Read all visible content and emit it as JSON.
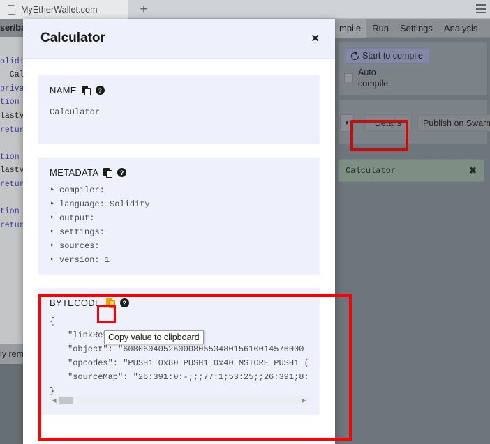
{
  "browser": {
    "tab_title": "MyEtherWallet.com",
    "new_tab_label": "+",
    "page_icon": "page-icon",
    "menu_icon": "hamburger-menu-icon"
  },
  "editor": {
    "path_label": "ser/ba",
    "lines": [
      {
        "text": "olidit",
        "kind": "kw"
      },
      {
        "text": "  Calcu",
        "kind": "pl"
      },
      {
        "text": "privat",
        "kind": "kw"
      },
      {
        "text": "tion A",
        "kind": "kw"
      },
      {
        "text": "lastVa",
        "kind": "pl"
      },
      {
        "text": "return",
        "kind": "kw"
      },
      {
        "text": "",
        "kind": "pl"
      },
      {
        "text": "tion S",
        "kind": "kw"
      },
      {
        "text": "lastVa",
        "kind": "pl"
      },
      {
        "text": "return",
        "kind": "kw"
      },
      {
        "text": "",
        "kind": "pl"
      },
      {
        "text": "tion L",
        "kind": "kw"
      },
      {
        "text": "return",
        "kind": "kw"
      }
    ],
    "status_text": "ly remi"
  },
  "right_panel": {
    "tabs": [
      {
        "label": "mpile",
        "active": true
      },
      {
        "label": "Run",
        "active": false
      },
      {
        "label": "Settings",
        "active": false
      },
      {
        "label": "Analysis",
        "active": false
      }
    ],
    "compile_button": "Start to compile",
    "compile_icon": "refresh-icon",
    "auto_compile_label": "Auto compile",
    "auto_compile_checked": false,
    "select_arrow": "▼",
    "details_button": "Details",
    "swarm_button": "Publish on Swarm",
    "contract_chip": {
      "name": "Calculator",
      "close": "✖"
    },
    "highlight_color": "#ff0000"
  },
  "modal": {
    "title": "Calculator",
    "close_label": "✕",
    "name_card": {
      "heading": "NAME",
      "copy_icon": "copy-icon",
      "help_icon": "help-icon",
      "value": "Calculator"
    },
    "metadata_card": {
      "heading": "METADATA",
      "copy_icon": "copy-icon",
      "help_icon": "help-icon",
      "items": [
        "compiler:",
        "language: Solidity",
        "output:",
        "settings:",
        "sources:",
        "version: 1"
      ]
    },
    "bytecode_card": {
      "heading": "BYTECODE",
      "copy_icon": "copy-icon-highlighted",
      "help_icon": "help-icon",
      "open_brace": "{",
      "close_brace": "}",
      "lines": [
        "\"linkReferences\": {},",
        "\"object\": \"608060405260008055348015610014576000",
        "\"opcodes\": \"PUSH1 0x80 PUSH1 0x40 MSTORE PUSH1 (",
        "\"sourceMap\": \"26:391:0:-;;;77:1;53:25;;26:391;8:"
      ],
      "scroll_left_arrow": "◀",
      "scroll_right_arrow": "▶"
    },
    "tooltip": "Copy value to clipboard"
  }
}
